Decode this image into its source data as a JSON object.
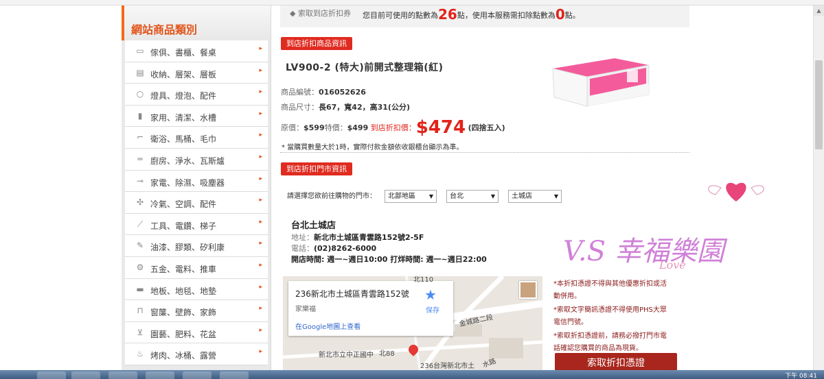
{
  "sidebar": {
    "title": "網站商品類別",
    "items": [
      {
        "label": "傢俱、書櫃、餐桌",
        "icon": "furniture-icon"
      },
      {
        "label": "收納、層架、層板",
        "icon": "storage-icon"
      },
      {
        "label": "燈具、燈泡、配件",
        "icon": "lightbulb-icon"
      },
      {
        "label": "家用、清潔、水槽",
        "icon": "spray-bottle-icon"
      },
      {
        "label": "衛浴、馬桶、毛巾",
        "icon": "toilet-icon"
      },
      {
        "label": "廚房、淨水、瓦斯爐",
        "icon": "range-hood-icon"
      },
      {
        "label": "家電、除濕、吸塵器",
        "icon": "plug-icon"
      },
      {
        "label": "冷氣、空調、配件",
        "icon": "fan-icon"
      },
      {
        "label": "工具、電鑽、梯子",
        "icon": "wrench-icon"
      },
      {
        "label": "油漆、膠類、矽利康",
        "icon": "paint-brush-icon"
      },
      {
        "label": "五金、電料、推車",
        "icon": "gear-icon"
      },
      {
        "label": "地板、地毯、地墊",
        "icon": "floor-icon"
      },
      {
        "label": "窗簾、壁飾、家飾",
        "icon": "curtain-icon"
      },
      {
        "label": "園藝、肥料、花盆",
        "icon": "plant-pot-icon"
      },
      {
        "label": "烤肉、冰桶、露營",
        "icon": "bbq-icon"
      }
    ]
  },
  "top_bar": {
    "tag": "索取到店折扣券",
    "msg_pre": "您目前可使用的點數為",
    "points_available": "26",
    "msg_mid": "點，使用本服務需扣除點數為",
    "points_required": "0",
    "msg_post": "點。"
  },
  "product": {
    "section_label": "到店折扣商品資訊",
    "title": "LV900-2 (特大)前開式整理箱(紅)",
    "code_label": "商品編號：",
    "code": "016052626",
    "size_label": "商品尺寸：",
    "size": "長67，寬42，高31(公分)",
    "orig_label": "原價：",
    "orig_price": "$599",
    "sale_label": "特價：",
    "sale_price": "$499",
    "discount_label": "到店折扣價：",
    "discount_price": "$474",
    "rounding": "(四捨五入)",
    "note": "* 當購買數量大於1時，實際付款金額依收銀櫃台顯示為準。"
  },
  "store": {
    "section_label": "到店折扣門市資訊",
    "select_prompt": "請選擇您欲前往購物的門市：",
    "region": "北部地區",
    "city": "台北",
    "branch": "土城店",
    "name": "台北土城店",
    "addr_label": "地址：",
    "address": "新北市土城區青雲路152號2-5F",
    "phone_label": "電話：",
    "phone": "(02)8262-6000",
    "hours": "開店時間: 週一~週日10:00 打烊時間: 週一~週日22:00"
  },
  "map": {
    "card_title": "236新北市土城區青雲路152號",
    "card_sub": "家樂福",
    "card_link": "在Google地圖上查看",
    "save": "保存",
    "labels": [
      "金城路二段",
      "新北市立中正國中",
      "北88",
      "236台灣新北市土",
      "水路",
      "北110"
    ]
  },
  "notes": {
    "line1": "*本折扣憑證不得與其他優惠折扣或活",
    "line2": "動併用。",
    "line3": "*索取文字簡訊憑證不得使用PHS大眾",
    "line4": "電信門號。",
    "line5": "*索取折扣憑證前，請務必撥打門市電",
    "line6": "話確認您購買的商品為現貨。",
    "button": "索取折扣憑證"
  },
  "watermark": {
    "text": "V.S 幸福樂園",
    "script": "Love"
  },
  "taskbar": {
    "clock": "下午 08:41"
  },
  "colors": {
    "accent": "#e2541a",
    "red": "#e02b20",
    "dark_red": "#a8261d",
    "note_red": "#8b1a1a"
  }
}
